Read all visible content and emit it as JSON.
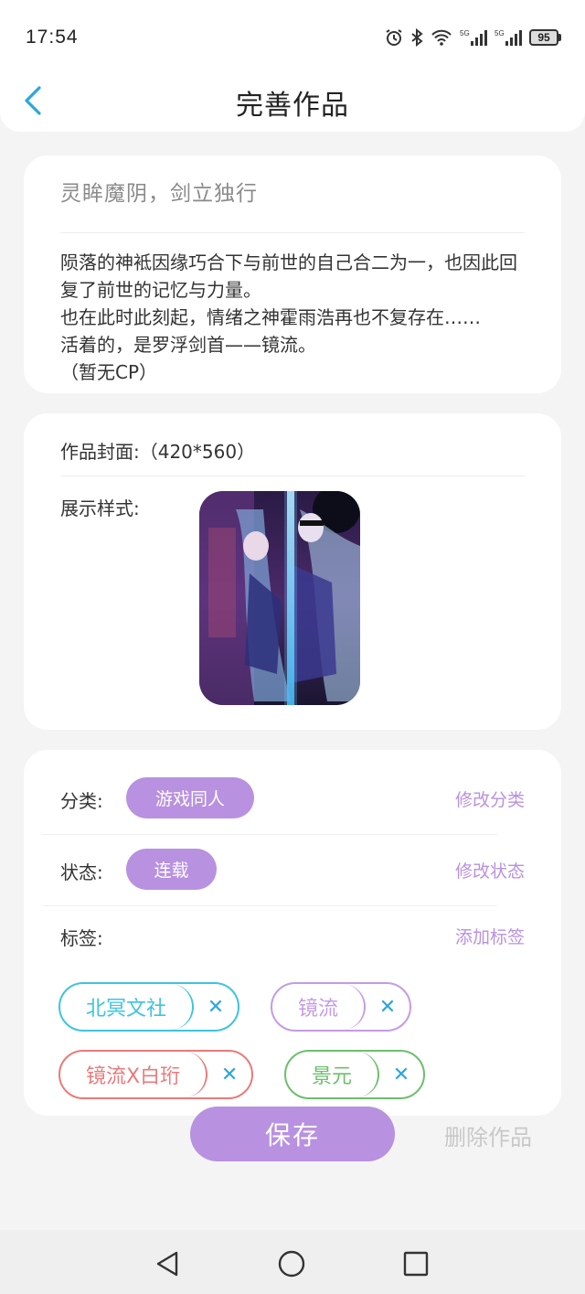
{
  "status_bar": {
    "time": "17:54",
    "battery": "95",
    "network_label": "5G"
  },
  "nav": {
    "title": "完善作品"
  },
  "work": {
    "title": "灵眸魔阴，剑立独行",
    "description": "陨落的神袛因缘巧合下与前世的自己合二为一，也因此回复了前世的记忆与力量。\n也在此时此刻起，情绪之神霍雨浩再也不复存在……\n活着的，是罗浮剑首——镜流。\n（暂无CP）"
  },
  "cover": {
    "label": "作品封面:（420*560）",
    "style_label": "展示样式:"
  },
  "meta": {
    "category_label": "分类:",
    "category_value": "游戏同人",
    "category_action": "修改分类",
    "status_label": "状态:",
    "status_value": "连载",
    "status_action": "修改状态",
    "tags_label": "标签:",
    "tags_action": "添加标签"
  },
  "tags": [
    {
      "label": "北冥文社",
      "color": "#3ec3e0",
      "remove": "✕"
    },
    {
      "label": "镜流",
      "color": "#c49be6",
      "remove": "✕"
    },
    {
      "label": "镜流X白珩",
      "color": "#ea7a7a",
      "remove": "✕"
    },
    {
      "label": "景元",
      "color": "#6cbf6c",
      "remove": "✕"
    }
  ],
  "actions": {
    "save": "保存",
    "delete": "删除作品"
  },
  "colors": {
    "accent": "#b891e0",
    "back_arrow": "#2aa6e0"
  }
}
